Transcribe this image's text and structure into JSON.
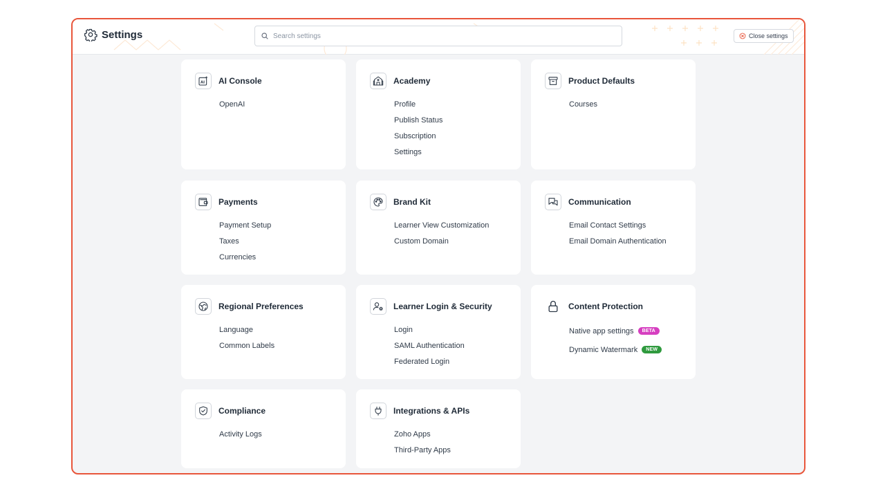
{
  "header": {
    "title": "Settings",
    "title_icon": "gear-icon",
    "search_placeholder": "Search settings",
    "search_value": "",
    "close_label": "Close settings",
    "close_icon": "close-circle-icon"
  },
  "colors": {
    "accent": "#e8553a",
    "beta": "#d63fc0",
    "new": "#2f9a3e"
  },
  "cards": [
    {
      "title": "AI Console",
      "icon": "ai-sparkle-icon",
      "links": [
        {
          "label": "OpenAI"
        }
      ]
    },
    {
      "title": "Academy",
      "icon": "building-icon",
      "links": [
        {
          "label": "Profile"
        },
        {
          "label": "Publish Status"
        },
        {
          "label": "Subscription"
        },
        {
          "label": "Settings"
        }
      ]
    },
    {
      "title": "Product Defaults",
      "icon": "archive-box-icon",
      "links": [
        {
          "label": "Courses"
        }
      ]
    },
    {
      "title": "Payments",
      "icon": "wallet-icon",
      "links": [
        {
          "label": "Payment Setup"
        },
        {
          "label": "Taxes"
        },
        {
          "label": "Currencies"
        }
      ]
    },
    {
      "title": "Brand Kit",
      "icon": "palette-icon",
      "links": [
        {
          "label": "Learner View Customization"
        },
        {
          "label": "Custom Domain"
        }
      ]
    },
    {
      "title": "Communication",
      "icon": "chat-bubbles-icon",
      "links": [
        {
          "label": "Email Contact Settings"
        },
        {
          "label": "Email Domain Authentication"
        }
      ]
    },
    {
      "title": "Regional Preferences",
      "icon": "globe-icon",
      "links": [
        {
          "label": "Language"
        },
        {
          "label": "Common Labels"
        }
      ]
    },
    {
      "title": "Learner Login & Security",
      "icon": "user-gear-icon",
      "links": [
        {
          "label": "Login"
        },
        {
          "label": "SAML Authentication"
        },
        {
          "label": "Federated Login"
        }
      ]
    },
    {
      "title": "Content Protection",
      "icon": "lock-icon",
      "links": [
        {
          "label": "Native app settings",
          "badge": "BETA"
        },
        {
          "label": "Dynamic Watermark",
          "badge": "NEW"
        }
      ]
    },
    {
      "title": "Compliance",
      "icon": "shield-check-icon",
      "links": [
        {
          "label": "Activity Logs"
        }
      ]
    },
    {
      "title": "Integrations & APIs",
      "icon": "plug-icon",
      "links": [
        {
          "label": "Zoho Apps"
        },
        {
          "label": "Third-Party Apps"
        }
      ]
    }
  ]
}
